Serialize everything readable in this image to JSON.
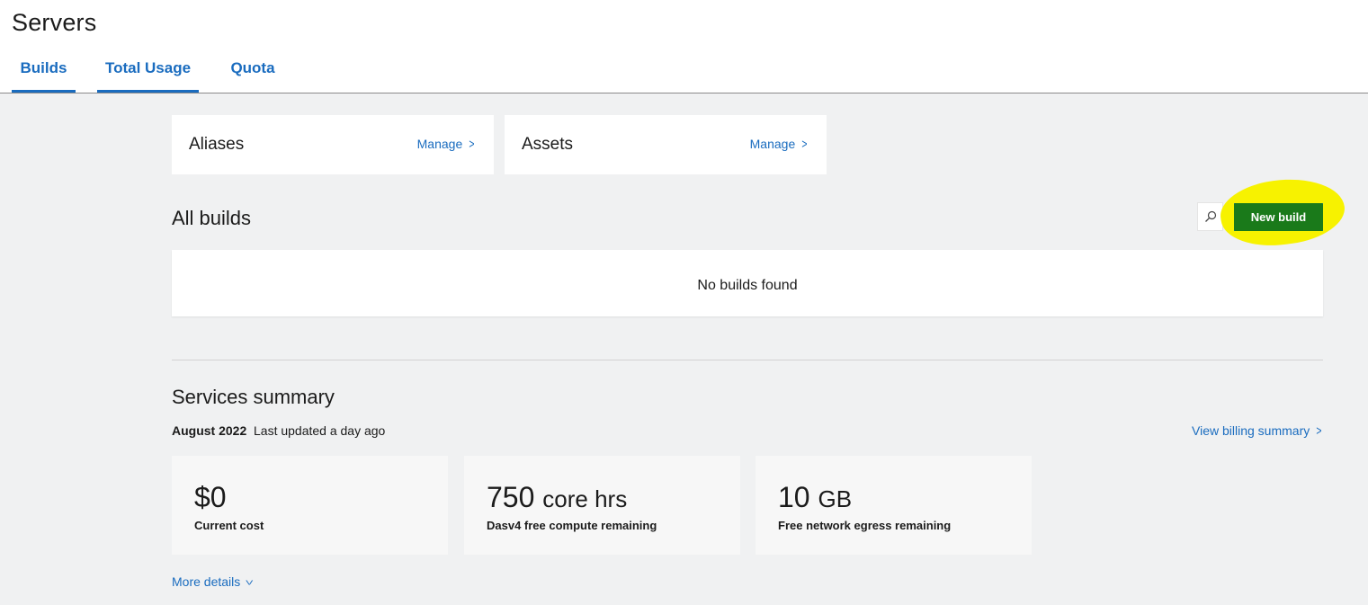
{
  "page": {
    "title": "Servers"
  },
  "tabs": [
    {
      "label": "Builds"
    },
    {
      "label": "Total Usage"
    },
    {
      "label": "Quota"
    }
  ],
  "management": {
    "aliases": {
      "title": "Aliases",
      "link": "Manage"
    },
    "assets": {
      "title": "Assets",
      "link": "Manage"
    }
  },
  "builds": {
    "title": "All builds",
    "new_button": "New build",
    "empty_text": "No builds found"
  },
  "summary": {
    "title": "Services summary",
    "month": "August 2022",
    "updated": "Last updated a day ago",
    "billing_link": "View billing summary",
    "stats": [
      {
        "value": "$0",
        "unit": "",
        "label": "Current cost"
      },
      {
        "value": "750",
        "unit": "core hrs",
        "label": "Dasv4 free compute remaining"
      },
      {
        "value": "10",
        "unit": "GB",
        "label": "Free network egress remaining"
      }
    ],
    "more_details": "More details"
  },
  "colors": {
    "accent": "#1a6cbf",
    "highlight": "#f7f200",
    "button_overlay": "#1a7a1a"
  },
  "icons": {
    "search": "search-icon",
    "chevron_right": "chevron-right-icon",
    "chevron_down": "chevron-down-icon"
  }
}
